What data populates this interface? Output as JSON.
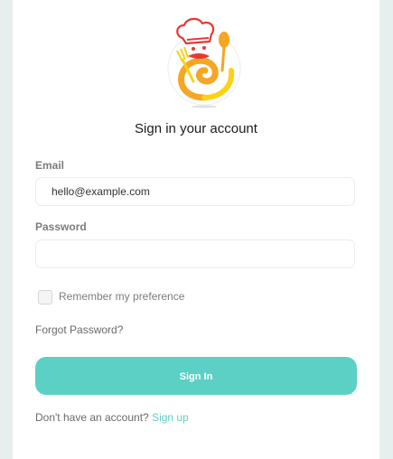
{
  "heading": "Sign in your account",
  "email": {
    "label": "Email",
    "value": "hello@example.com"
  },
  "password": {
    "label": "Password",
    "value": ""
  },
  "remember": {
    "label": "Remember my preference",
    "checked": false
  },
  "forgot_label": "Forgot Password?",
  "sign_in_label": "Sign In",
  "signup": {
    "prompt": "Don't have an account?",
    "link": "Sign up"
  },
  "colors": {
    "accent": "#5dd0c5",
    "logo_orange": "#f5a623",
    "logo_yellow": "#fcd116",
    "logo_red": "#e53935"
  },
  "icons": [
    "chef-logo-icon"
  ]
}
